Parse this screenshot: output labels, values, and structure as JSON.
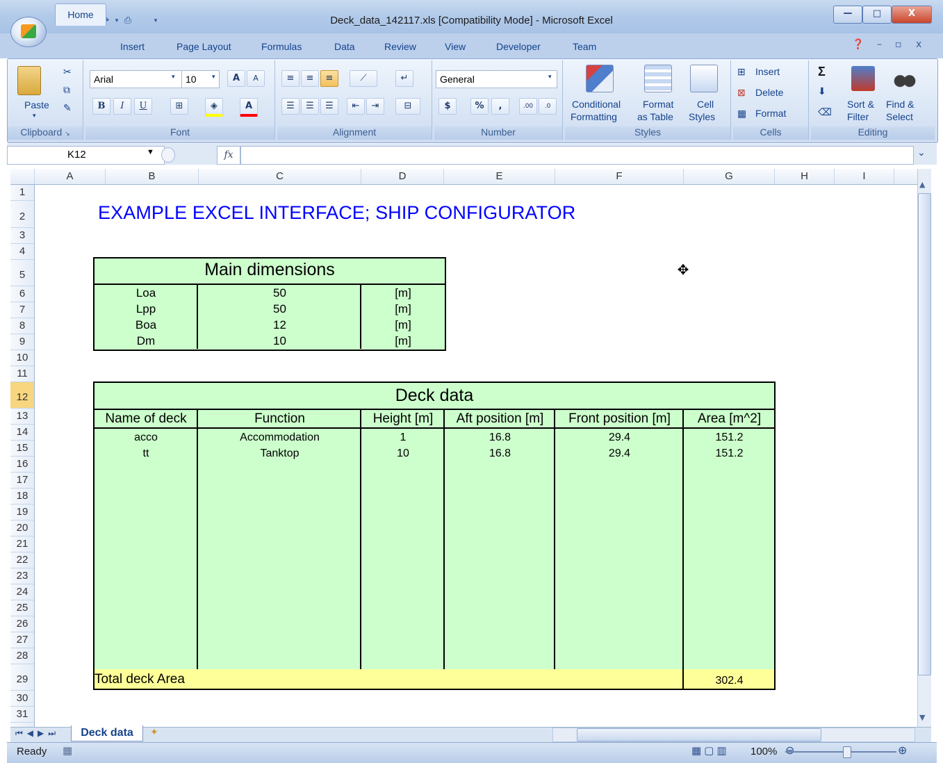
{
  "window": {
    "title": "Deck_data_142117.xls  [Compatibility Mode] - Microsoft Excel",
    "controls": {
      "minimize": "—",
      "maximize": "□",
      "close": "X"
    }
  },
  "quick_access": {
    "save": "save-icon",
    "undo": "undo-icon",
    "redo": "redo-icon",
    "print": "print-icon"
  },
  "ribbon": {
    "tabs": [
      "Home",
      "Insert",
      "Page Layout",
      "Formulas",
      "Data",
      "Review",
      "View",
      "Developer",
      "Team"
    ],
    "clipboard": {
      "label": "Clipboard",
      "paste": "Paste"
    },
    "font": {
      "label": "Font",
      "name": "Arial",
      "size": "10",
      "bold": "B",
      "italic": "I",
      "underline": "U",
      "grow": "A",
      "shrink": "A",
      "color": "A"
    },
    "alignment": {
      "label": "Alignment"
    },
    "number": {
      "label": "Number",
      "format": "General",
      "currency": "$",
      "percent": "%",
      "comma": ",",
      "inc_dec": ".00",
      "dec_dec": ".0"
    },
    "styles": {
      "label": "Styles",
      "conditional_1": "Conditional",
      "conditional_2": "Formatting",
      "format_table_1": "Format",
      "format_table_2": "as Table",
      "cell_styles_1": "Cell",
      "cell_styles_2": "Styles"
    },
    "cells": {
      "label": "Cells",
      "insert": "Insert",
      "delete": "Delete",
      "format": "Format"
    },
    "editing": {
      "label": "Editing",
      "sort_1": "Sort &",
      "sort_2": "Filter",
      "find_1": "Find &",
      "find_2": "Select",
      "sum": "Σ"
    }
  },
  "formula_bar": {
    "name_box": "K12",
    "fx": "fx",
    "value": ""
  },
  "columns": [
    "A",
    "B",
    "C",
    "D",
    "E",
    "F",
    "G",
    "H",
    "I"
  ],
  "rows": [
    "1",
    "2",
    "3",
    "4",
    "5",
    "6",
    "7",
    "8",
    "9",
    "10",
    "11",
    "12",
    "13",
    "14",
    "15",
    "16",
    "17",
    "18",
    "19",
    "20",
    "21",
    "22",
    "23",
    "24",
    "25",
    "26",
    "27",
    "28",
    "29",
    "30",
    "31"
  ],
  "sheet": {
    "title": "EXAMPLE EXCEL INTERFACE; SHIP CONFIGURATOR",
    "main_dimensions": {
      "heading": "Main dimensions",
      "rows": [
        {
          "name": "Loa",
          "value": "50",
          "unit": "[m]"
        },
        {
          "name": "Lpp",
          "value": "50",
          "unit": "[m]"
        },
        {
          "name": "Boa",
          "value": "12",
          "unit": "[m]"
        },
        {
          "name": "Dm",
          "value": "10",
          "unit": "[m]"
        }
      ]
    },
    "deck_data": {
      "heading": "Deck data",
      "headers": [
        "Name of deck",
        "Function",
        "Height [m]",
        "Aft position [m]",
        "Front position [m]",
        "Area [m^2]"
      ],
      "rows": [
        [
          "acco",
          "Accommodation",
          "1",
          "16.8",
          "29.4",
          "151.2"
        ],
        [
          "tt",
          "Tanktop",
          "10",
          "16.8",
          "29.4",
          "151.2"
        ]
      ],
      "total_label": "Total deck Area",
      "total_value": "302.4"
    }
  },
  "sheet_tabs": {
    "active": "Deck data"
  },
  "status": {
    "ready": "Ready",
    "zoom": "100%"
  },
  "colors": {
    "green_fill": "#ccffcc",
    "total_fill": "#ffff99",
    "title_blue": "#0000ff"
  }
}
